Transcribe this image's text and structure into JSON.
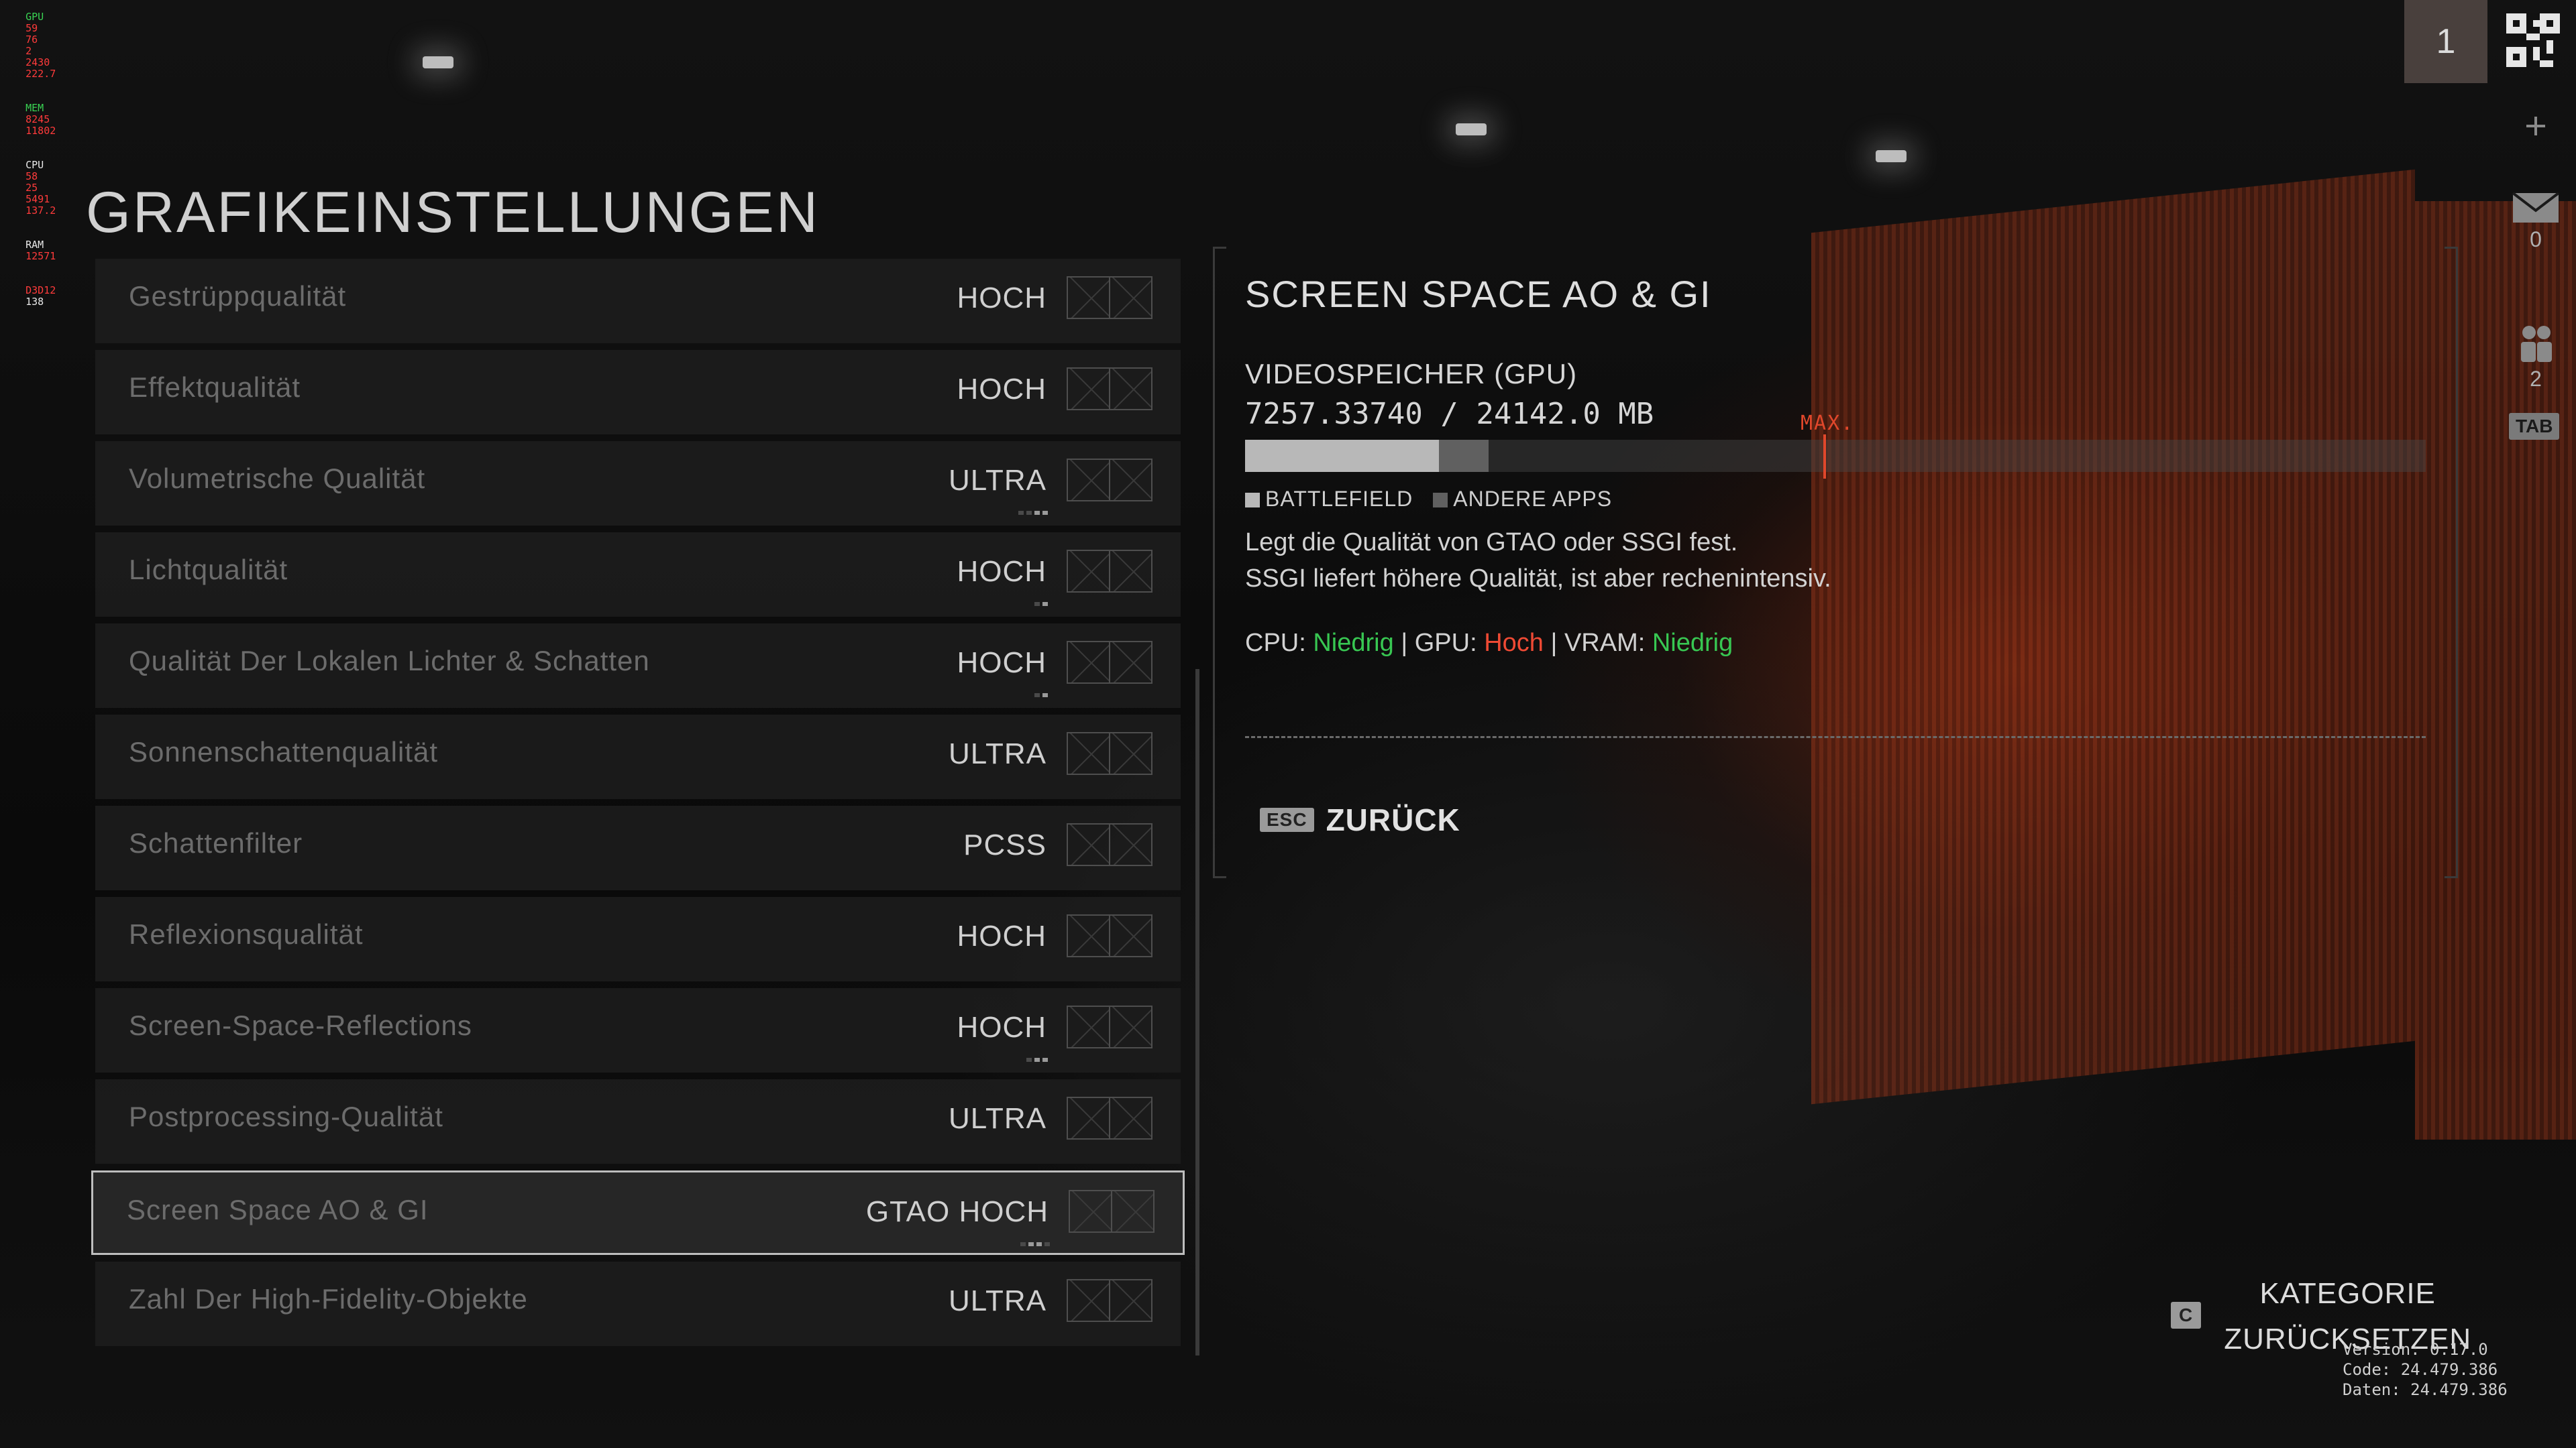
{
  "perf_overlay": {
    "rows": [
      {
        "label": "GPU",
        "v1": "59",
        "v2": "76",
        "v3": "2",
        "v4": "2430",
        "v5": "222.7"
      },
      {
        "label": "MEM",
        "v1": "8245",
        "v2": "11802"
      },
      {
        "label": "CPU",
        "v1": "58",
        "v2": "25",
        "v3": "5491",
        "v4": "137.2"
      },
      {
        "label": "RAM",
        "v1": "12571"
      },
      {
        "label": "D3D12",
        "v1": "138"
      }
    ]
  },
  "page": {
    "title": "GRAFIKEINSTELLUNGEN"
  },
  "settings": [
    {
      "label": "Gestrüppqualität",
      "value": "HOCH"
    },
    {
      "label": "Effektqualität",
      "value": "HOCH"
    },
    {
      "label": "Volumetrische Qualität",
      "value": "ULTRA"
    },
    {
      "label": "Lichtqualität",
      "value": "HOCH"
    },
    {
      "label": "Qualität Der Lokalen Lichter & Schatten",
      "value": "HOCH"
    },
    {
      "label": "Sonnenschattenqualität",
      "value": "ULTRA"
    },
    {
      "label": "Schattenfilter",
      "value": "PCSS"
    },
    {
      "label": "Reflexionsqualität",
      "value": "HOCH"
    },
    {
      "label": "Screen-Space-Reflections",
      "value": "HOCH"
    },
    {
      "label": "Postprocessing-Qualität",
      "value": "ULTRA"
    },
    {
      "label": "Screen Space AO & GI",
      "value": "GTAO HOCH"
    },
    {
      "label": "Zahl Der High-Fidelity-Objekte",
      "value": "ULTRA"
    }
  ],
  "selected_index": 10,
  "detail": {
    "title": "SCREEN SPACE AO & GI",
    "vram_label": "VIDEOSPEICHER (GPU)",
    "vram_value": "7257.33740 / 24142.0 MB",
    "vram_used_battlefield_fraction": 0.164,
    "vram_used_other_fraction": 0.042,
    "vram_max_fraction": 0.49,
    "max_label": "MAX.",
    "legend": [
      {
        "label": "BATTLEFIELD",
        "color": "#b8b8b8"
      },
      {
        "label": "ANDERE APPS",
        "color": "#606060"
      }
    ],
    "description_line1": "Legt die Qualität von GTAO oder SSGI fest.",
    "description_line2": "SSGI liefert höhere Qualität, ist aber rechenintensiv.",
    "impact": {
      "cpu_label": "CPU:",
      "cpu_value": "Niedrig",
      "gpu_label": "GPU:",
      "gpu_value": "Hoch",
      "vram_label": "VRAM:",
      "vram_value": "Niedrig",
      "separator": "|"
    }
  },
  "actions": {
    "back_key": "ESC",
    "back_label": "ZURÜCK",
    "reset_key": "C",
    "reset_line1": "KATEGORIE",
    "reset_line2": "ZURÜCKSETZEN"
  },
  "version_info": {
    "version": "Version: 0.17.0",
    "code": "Code: 24.479.386",
    "data": "Daten: 24.479.386"
  },
  "sidebar": {
    "player_number": "1",
    "mail_count": "0",
    "squad_count": "2",
    "tab_key": "TAB"
  },
  "colors": {
    "green": "#38c752",
    "red": "#ef4a34",
    "accent_max": "#e0472b"
  }
}
